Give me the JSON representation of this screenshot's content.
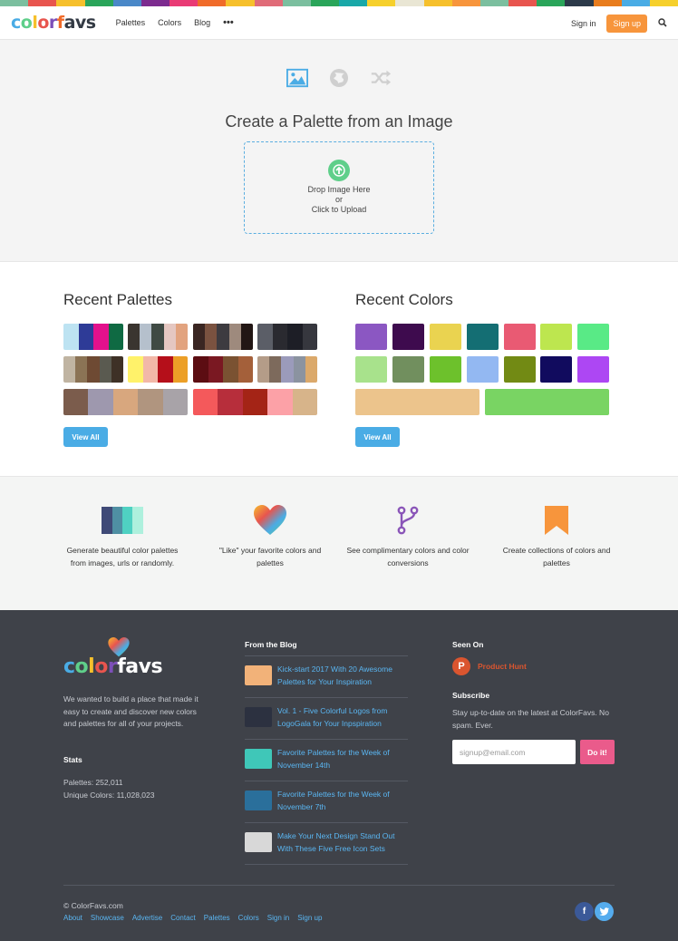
{
  "stripe_colors": [
    "#7bbf9f",
    "#e8554e",
    "#f6c02c",
    "#2aa55a",
    "#4a88c8",
    "#7c2b8f",
    "#e93b75",
    "#f06b2a",
    "#f6c02c",
    "#e06b78",
    "#7bbf9f",
    "#2aa55a",
    "#19a8a8",
    "#f6d02c",
    "#e9e6d4",
    "#f6c02c",
    "#f7953c",
    "#7bbf9f",
    "#e8554e",
    "#2aa55a",
    "#2c3a4a",
    "#e87c1d",
    "#4aace5",
    "#f6d02c"
  ],
  "nav": {
    "logo_parts": [
      {
        "t": "c",
        "c": "#4aace5"
      },
      {
        "t": "o",
        "c": "#5fcf8a"
      },
      {
        "t": "l",
        "c": "#f6c02c"
      },
      {
        "t": "o",
        "c": "#e8554e"
      },
      {
        "t": "r",
        "c": "#7c4fb8"
      },
      {
        "t": "f",
        "c": "#f06b2a"
      },
      {
        "t": "a",
        "c": "#333a44"
      },
      {
        "t": "v",
        "c": "#333a44"
      },
      {
        "t": "s",
        "c": "#333a44"
      }
    ],
    "links": [
      "Palettes",
      "Colors",
      "Blog"
    ],
    "more": "•••",
    "signin": "Sign in",
    "signup": "Sign up"
  },
  "hero": {
    "title": "Create a Palette from an Image",
    "drop1": "Drop Image Here",
    "drop2": "or",
    "drop3": "Click to Upload",
    "icons": [
      "image-icon",
      "globe-icon",
      "shuffle-icon"
    ]
  },
  "recent_palettes": {
    "title": "Recent Palettes",
    "view_all": "View All",
    "palettes": [
      [
        "#bde3f2",
        "#2e3b97",
        "#e3118c",
        "#0f6a43"
      ],
      [
        "#3a3530",
        "#b5c0cc",
        "#3f4a44",
        "#e5c7c1",
        "#e2a37f"
      ],
      [
        "#3a2622",
        "#7a5240",
        "#3d3b40",
        "#9e8a7d",
        "#221614"
      ],
      [
        "#5b5e67",
        "#2a2a30",
        "#1d1e26",
        "#36373e"
      ],
      [
        "#c0b4a2",
        "#8b7355",
        "#6e4a33",
        "#5a5a50",
        "#3e3126"
      ],
      [
        "#fff26a",
        "#f2b8a8",
        "#b50f1a",
        "#ec9f27"
      ],
      [
        "#5c0d12",
        "#7a1822",
        "#7a5232",
        "#a4603a"
      ],
      [
        "#b49c88",
        "#7d6a5c",
        "#9b9bbb",
        "#8b93a0",
        "#dba96b"
      ],
      [
        "#7b5c4c",
        "#9e98ae",
        "#d8a77e",
        "#b0957f",
        "#a8a3a8"
      ],
      [
        "#f4595b",
        "#b72e3b",
        "#a42416",
        "#fca1a7",
        "#d7b48a"
      ]
    ]
  },
  "recent_colors": {
    "title": "Recent Colors",
    "view_all": "View All",
    "colors": [
      "#8b57c2",
      "#3e0b4e",
      "#ead350",
      "#146e73",
      "#e95a73",
      "#bde64f",
      "#59ea86",
      "#a8e28c",
      "#718f5e",
      "#6dc12c",
      "#93b8f2",
      "#728a14",
      "#110b5e",
      "#ad47f3",
      "#ecc48c",
      "#79d463"
    ]
  },
  "features": [
    {
      "icon": "palette-swatch-icon",
      "text": "Generate beautiful color palettes from images, urls or randomly."
    },
    {
      "icon": "heart-icon",
      "text": "\"Like\" your favorite colors and palettes"
    },
    {
      "icon": "fork-icon",
      "text": "See complimentary colors and color conversions"
    },
    {
      "icon": "bookmark-icon",
      "text": "Create collections of colors and palettes"
    }
  ],
  "footer": {
    "about": "We wanted to build a place that made it easy to create and discover new colors and palettes for all of your projects.",
    "stats_title": "Stats",
    "stats_palettes": "Palettes: 252,011",
    "stats_colors": "Unique Colors: 11,028,023",
    "blog_title": "From the Blog",
    "blog": [
      {
        "text": "Kick-start 2017 With 20 Awesome Palettes for Your Inspiration",
        "thumb": "#f2b279"
      },
      {
        "text": "Vol. 1 - Five Colorful Logos from LogoGala for Your Inpspiration",
        "thumb": "#2c3140"
      },
      {
        "text": "Favorite Palettes for the Week of November 14th",
        "thumb": "#3fc7b8"
      },
      {
        "text": "Favorite Palettes for the Week of November 7th",
        "thumb": "#2a6f9b"
      },
      {
        "text": "Make Your Next Design Stand Out With These Five Free Icon Sets",
        "thumb": "#d8d8d8"
      }
    ],
    "seen_on_title": "Seen On",
    "product_hunt": "Product Hunt",
    "subscribe_title": "Subscribe",
    "subscribe_text": "Stay up-to-date on the latest at ColorFavs. No spam. Ever.",
    "email_placeholder": "signup@email.com",
    "doit": "Do it!",
    "copyright": "© ColorFavs.com",
    "links": [
      "About",
      "Showcase",
      "Advertise",
      "Contact",
      "Palettes",
      "Colors",
      "Sign in",
      "Sign up"
    ]
  }
}
